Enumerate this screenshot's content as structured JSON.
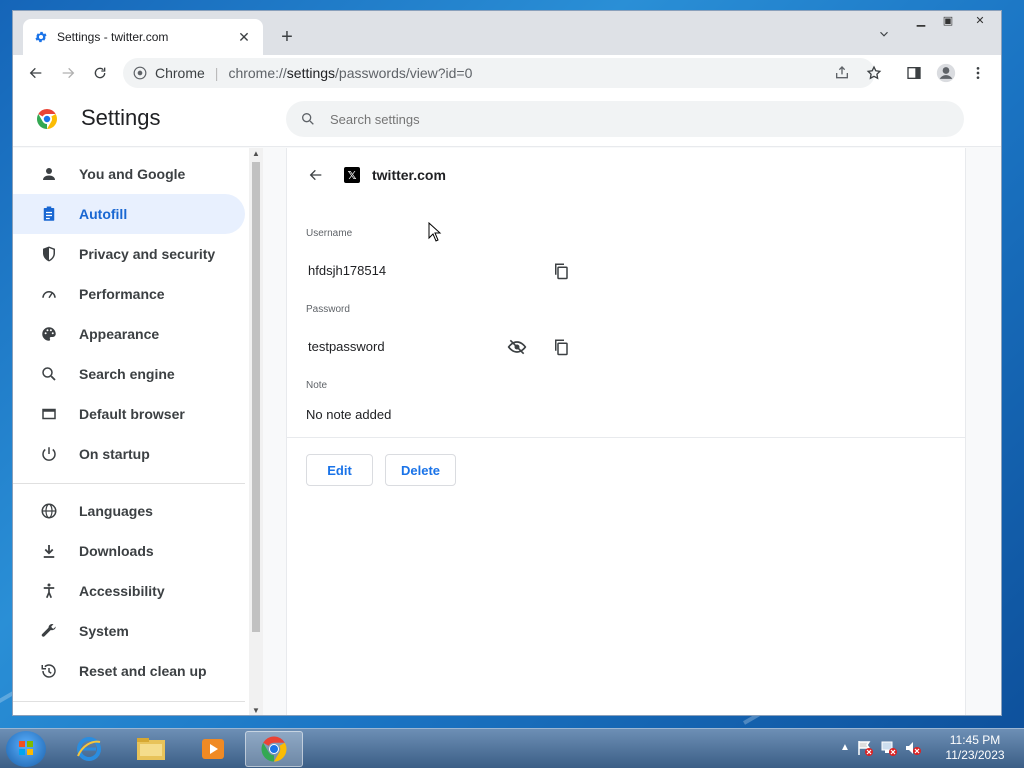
{
  "browser": {
    "tab_title": "Settings - twitter.com",
    "omnibox_label": "Chrome",
    "url_scheme": "chrome://",
    "url_host": "settings",
    "url_path": "/passwords/view?id=0"
  },
  "header": {
    "title": "Settings",
    "search_placeholder": "Search settings"
  },
  "sidebar": {
    "items": [
      {
        "label": "You and Google",
        "icon": "person-icon"
      },
      {
        "label": "Autofill",
        "icon": "clipboard-icon",
        "active": true
      },
      {
        "label": "Privacy and security",
        "icon": "shield-icon"
      },
      {
        "label": "Performance",
        "icon": "speedometer-icon"
      },
      {
        "label": "Appearance",
        "icon": "palette-icon"
      },
      {
        "label": "Search engine",
        "icon": "search-icon"
      },
      {
        "label": "Default browser",
        "icon": "browser-icon"
      },
      {
        "label": "On startup",
        "icon": "power-icon"
      },
      {
        "label": "Languages",
        "icon": "globe-icon"
      },
      {
        "label": "Downloads",
        "icon": "download-icon"
      },
      {
        "label": "Accessibility",
        "icon": "accessibility-icon"
      },
      {
        "label": "System",
        "icon": "wrench-icon"
      },
      {
        "label": "Reset and clean up",
        "icon": "history-icon"
      }
    ]
  },
  "password_detail": {
    "site": "twitter.com",
    "username_label": "Username",
    "username": "hfdsjh178514",
    "password_label": "Password",
    "password": "testpassword",
    "note_label": "Note",
    "note": "No note added",
    "edit_label": "Edit",
    "delete_label": "Delete"
  },
  "taskbar": {
    "time": "11:45 PM",
    "date": "11/23/2023"
  },
  "colors": {
    "accent": "#1a73e8",
    "active_bg": "#e8f0fe"
  }
}
